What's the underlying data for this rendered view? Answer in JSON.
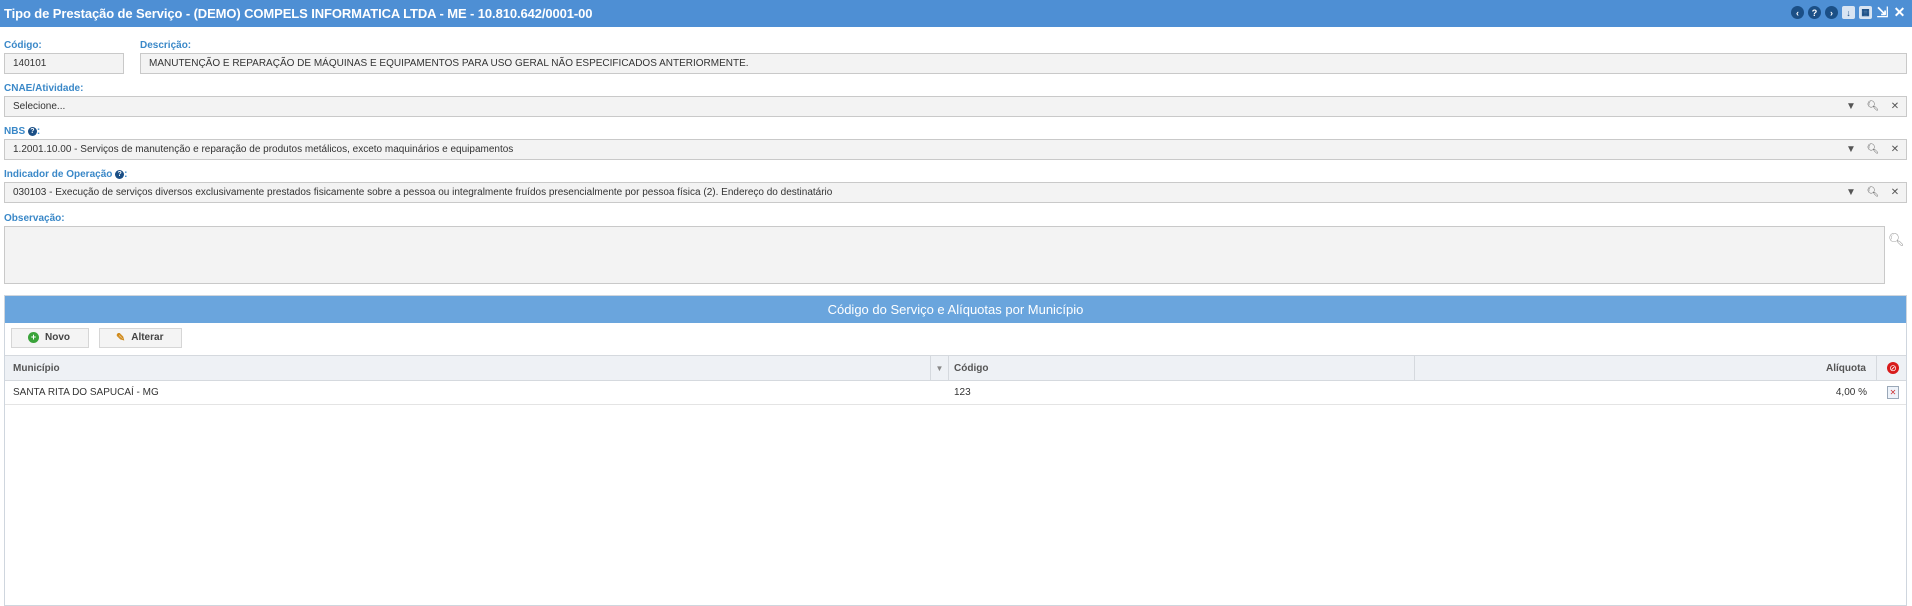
{
  "window": {
    "title": "Tipo de Prestação de Serviço - (DEMO) COMPELS INFORMATICA LTDA - ME - 10.810.642/0001-00"
  },
  "form": {
    "codigo_label": "Código:",
    "codigo_value": "140101",
    "descricao_label": "Descrição:",
    "descricao_value": "MANUTENÇÃO E REPARAÇÃO DE MÁQUINAS E EQUIPAMENTOS PARA USO GERAL NÃO ESPECIFICADOS ANTERIORMENTE.",
    "cnae_label": "CNAE/Atividade:",
    "cnae_value": "Selecione...",
    "nbs_label": "NBS",
    "nbs_value": "1.2001.10.00 - Serviços de manutenção e reparação de produtos metálicos, exceto maquinários e equipamentos",
    "indicador_label": "Indicador de Operação",
    "indicador_value": "030103 - Execução de serviços diversos exclusivamente prestados fisicamente sobre a pessoa ou integralmente fruídos presencialmente por pessoa física (2). Endereço do destinatário",
    "observacao_label": "Observação:",
    "observacao_value": ""
  },
  "grid": {
    "title": "Código do Serviço e Alíquotas por Município",
    "buttons": {
      "novo": "Novo",
      "alterar": "Alterar"
    },
    "columns": {
      "municipio": "Município",
      "codigo": "Código",
      "aliquota": "Alíquota"
    },
    "rows": [
      {
        "municipio": "SANTA RITA DO SAPUCAÍ - MG",
        "codigo": "123",
        "aliquota": "4,00 %"
      }
    ]
  },
  "colors": {
    "titlebar": "#4e8fd4",
    "label": "#3a88c8",
    "grid_header": "#6aa5dd"
  }
}
